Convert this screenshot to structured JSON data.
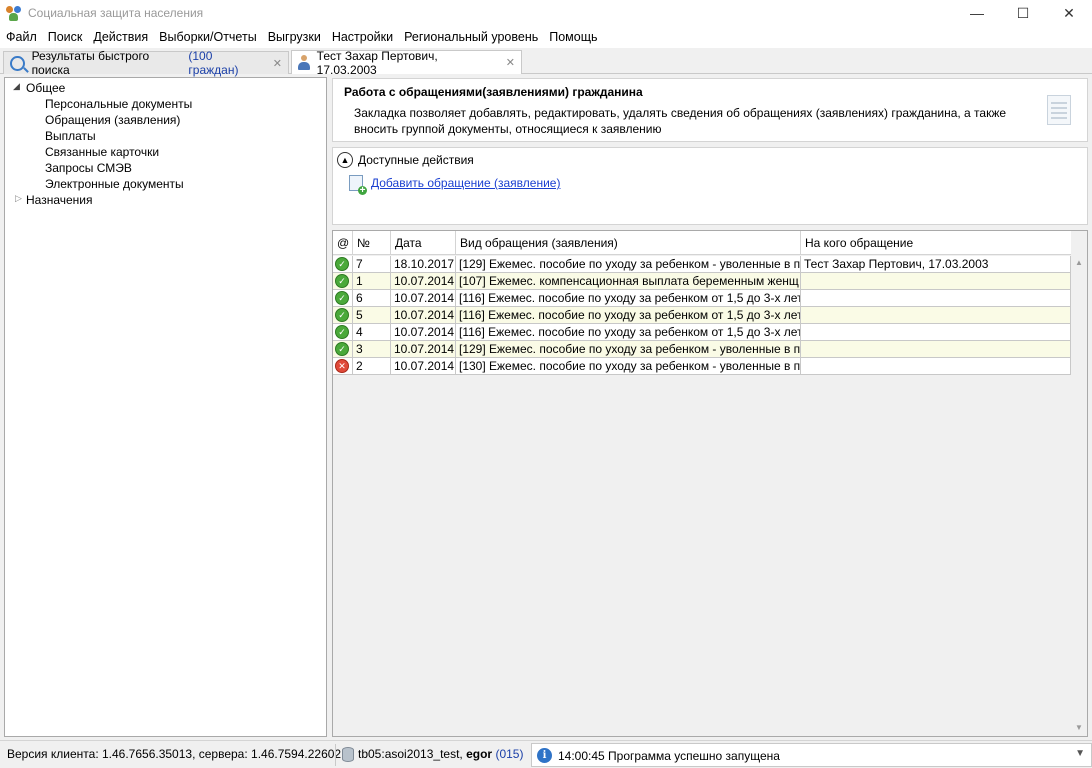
{
  "window": {
    "title": "Социальная защита населения",
    "minimize": "—",
    "maximize": "☐",
    "close": "✕"
  },
  "menu": [
    "Файл",
    "Поиск",
    "Действия",
    "Выборки/Отчеты",
    "Выгрузки",
    "Настройки",
    "Региональный уровень",
    "Помощь"
  ],
  "tabs": {
    "search_label": "Результаты быстрого поиска",
    "search_count": "(100 граждан)",
    "person_label": "Тест Захар Пертович, 17.03.2003",
    "close_glyph": "✕"
  },
  "tree": {
    "general": "Общее",
    "items": [
      "Персональные документы",
      "Обращения (заявления)",
      "Выплаты",
      "Связанные карточки",
      "Запросы СМЭВ",
      "Электронные документы"
    ],
    "assignments": "Назначения"
  },
  "info": {
    "title": "Работа с обращениями(заявлениями) гражданина",
    "text": "Закладка позволяет добавлять, редактировать, удалять сведения об обращениях (заявлениях) гражданина, а также вносить группой документы, относящиеся к заявлению"
  },
  "actions": {
    "title": "Доступные действия",
    "add_link": "Добавить обращение (заявление)"
  },
  "grid": {
    "headers": {
      "status": "@",
      "num": "№",
      "date": "Дата",
      "kind": "Вид обращения (заявления)",
      "whom": "На кого обращение"
    },
    "rows": [
      {
        "status": "ok",
        "num": "7",
        "date": "18.10.2017",
        "kind": "[129] Ежемес. пособие по уходу за ребенком - уволенные в п",
        "whom": "Тест Захар Пертович, 17.03.2003"
      },
      {
        "status": "ok",
        "num": "1",
        "date": "10.07.2014",
        "kind": "[107] Ежемес. компенсационная выплата беременным женщ",
        "whom": ""
      },
      {
        "status": "ok",
        "num": "6",
        "date": "10.07.2014",
        "kind": "[116] Ежемес. пособие по уходу за ребенком от 1,5 до 3-х лет",
        "whom": ""
      },
      {
        "status": "ok",
        "num": "5",
        "date": "10.07.2014",
        "kind": "[116] Ежемес. пособие по уходу за ребенком от 1,5 до 3-х лет",
        "whom": ""
      },
      {
        "status": "ok",
        "num": "4",
        "date": "10.07.2014",
        "kind": "[116] Ежемес. пособие по уходу за ребенком от 1,5 до 3-х лет",
        "whom": ""
      },
      {
        "status": "ok",
        "num": "3",
        "date": "10.07.2014",
        "kind": "[129] Ежемес. пособие по уходу за ребенком - уволенные в п",
        "whom": ""
      },
      {
        "status": "error",
        "num": "2",
        "date": "10.07.2014",
        "kind": "[130] Ежемес. пособие по уходу за ребенком - уволенные в п",
        "whom": ""
      }
    ]
  },
  "status": {
    "version": "Версия клиента: 1.46.7656.35013, сервера: 1.46.7594.22602",
    "db": "tb05:asoi2013_test,",
    "user": "egor",
    "user_count": "(015)",
    "message": "14:00:45 Программа успешно запущена"
  },
  "colors": {
    "row_alt": "#fafbe6",
    "link": "#1a3fd0",
    "ok": "#4aa93a",
    "error": "#e04a3a"
  }
}
